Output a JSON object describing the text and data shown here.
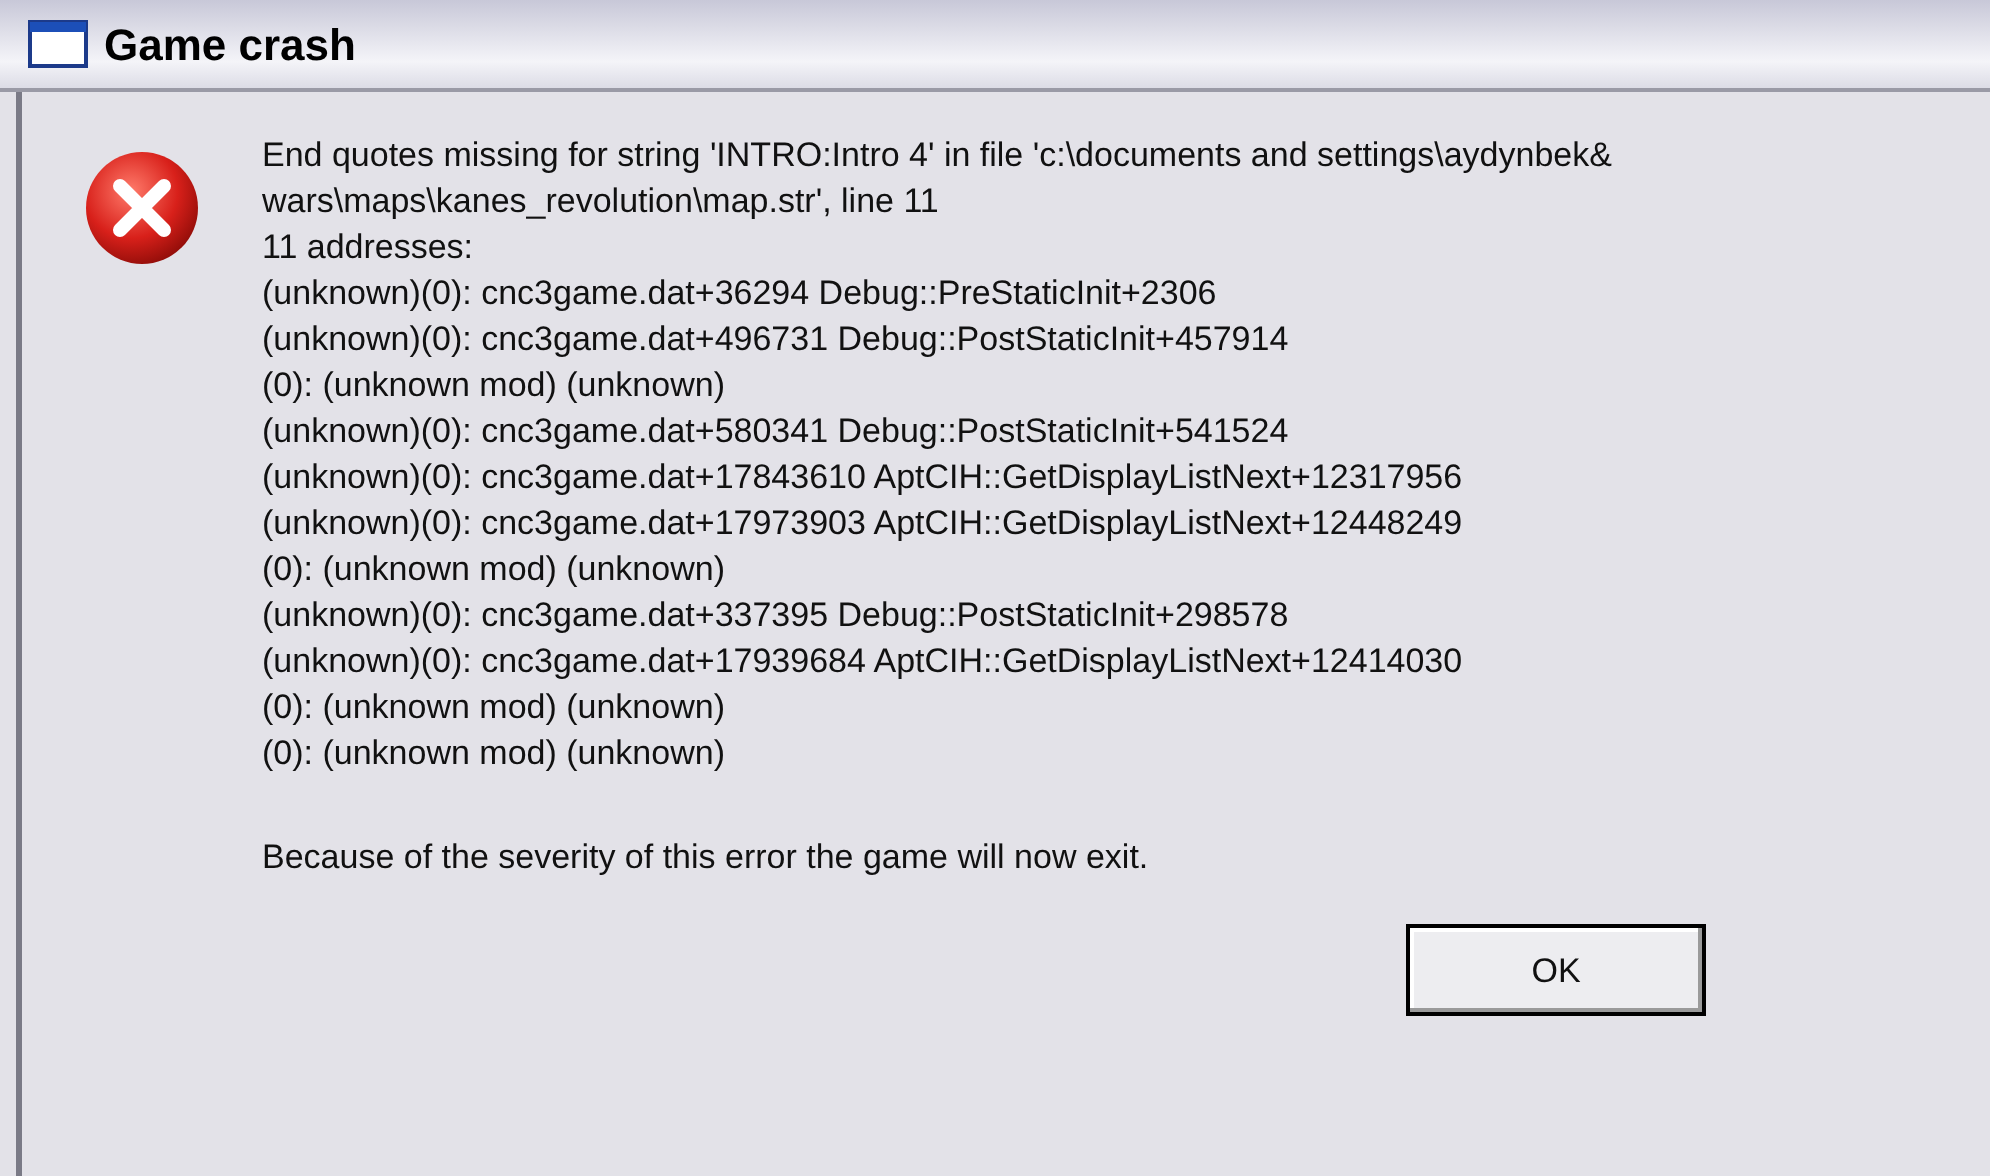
{
  "window": {
    "title": "Game crash"
  },
  "message_lines": [
    "End quotes missing for string 'INTRO:Intro 4' in file 'c:\\documents and settings\\aydynbek&",
    "wars\\maps\\kanes_revolution\\map.str', line 11",
    "11 addresses:",
    "(unknown)(0): cnc3game.dat+36294 Debug::PreStaticInit+2306",
    "(unknown)(0): cnc3game.dat+496731 Debug::PostStaticInit+457914",
    "(0): (unknown mod) (unknown)",
    "(unknown)(0): cnc3game.dat+580341 Debug::PostStaticInit+541524",
    "(unknown)(0): cnc3game.dat+17843610 AptCIH::GetDisplayListNext+12317956",
    "(unknown)(0): cnc3game.dat+17973903 AptCIH::GetDisplayListNext+12448249",
    "(0): (unknown mod) (unknown)",
    "(unknown)(0): cnc3game.dat+337395 Debug::PostStaticInit+298578",
    "(unknown)(0): cnc3game.dat+17939684 AptCIH::GetDisplayListNext+12414030",
    "(0): (unknown mod) (unknown)",
    "(0): (unknown mod) (unknown)"
  ],
  "footer_text": "Because of the severity of this error the game will now exit.",
  "buttons": [
    "OK"
  ]
}
